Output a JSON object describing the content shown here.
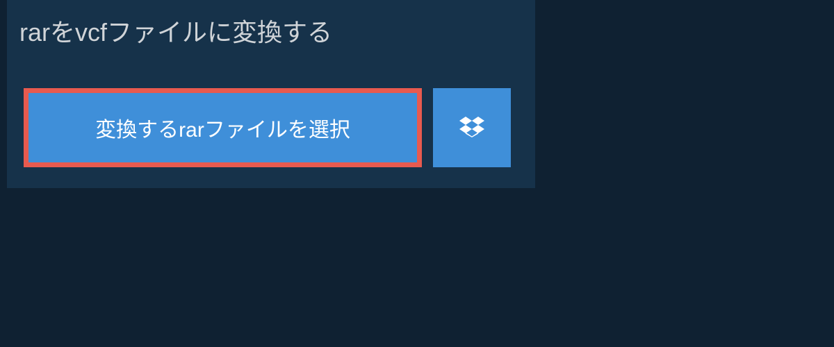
{
  "heading": "rarをvcfファイルに変換する",
  "select_button_label": "変換するrarファイルを選択"
}
